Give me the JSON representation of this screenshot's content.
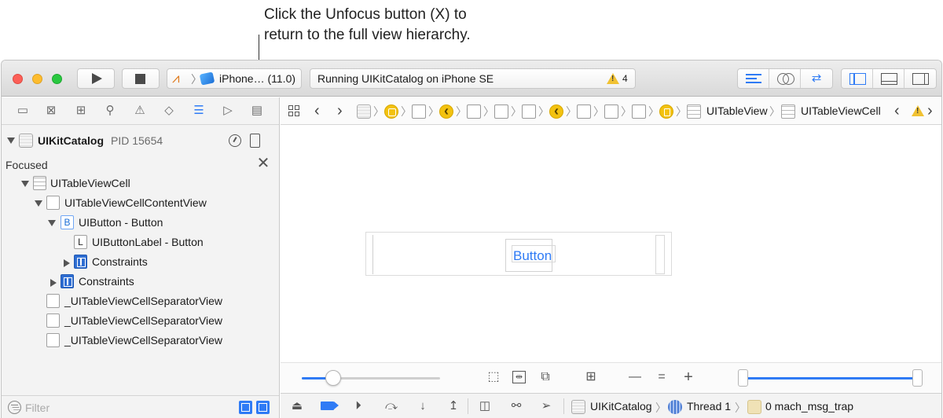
{
  "callout": {
    "line1": "Click the Unfocus button (X) to",
    "line2": "return to the full view hierarchy."
  },
  "toolbar": {
    "scheme_device": "iPhone… (11.0)",
    "status_text": "Running UIKitCatalog on iPhone SE",
    "warning_count": "4"
  },
  "navigator": {
    "process": {
      "name": "UIKitCatalog",
      "pid": "PID 15654"
    },
    "focused_label": "Focused",
    "unfocus_glyph": "✕",
    "tree": [
      {
        "label": "UITableViewCell",
        "icon": "table-cell-icon"
      },
      {
        "label": "UITableViewCellContentView",
        "icon": "view-icon"
      },
      {
        "label": "UIButton - Button",
        "icon": "button-icon",
        "icon_text": "B"
      },
      {
        "label": "UIButtonLabel - Button",
        "icon": "label-icon",
        "icon_text": "L"
      },
      {
        "label": "Constraints",
        "icon": "constraints-icon"
      },
      {
        "label": "Constraints",
        "icon": "constraints-icon"
      },
      {
        "label": "_UITableViewCellSeparatorView",
        "icon": "view-icon"
      },
      {
        "label": "_UITableViewCellSeparatorView",
        "icon": "view-icon"
      },
      {
        "label": "_UITableViewCellSeparatorView",
        "icon": "view-icon"
      }
    ],
    "filter_placeholder": "Filter"
  },
  "jumpbar": {
    "table_view_label": "UITableView",
    "cell_label": "UITableViewCell"
  },
  "canvas": {
    "button_text": "Button"
  },
  "canvas_bar": {
    "spacing_slider_fraction": 0.23,
    "range_low_fraction": 0.0,
    "range_high_fraction": 1.0
  },
  "debug_bar": {
    "process_label": "UIKitCatalog",
    "thread_label": "Thread 1",
    "frame_label": "0 mach_msg_trap"
  },
  "colors": {
    "accent": "#2f7bf5",
    "warning": "#f1c232",
    "breadcrumb_yellow": "#f3c20f"
  }
}
